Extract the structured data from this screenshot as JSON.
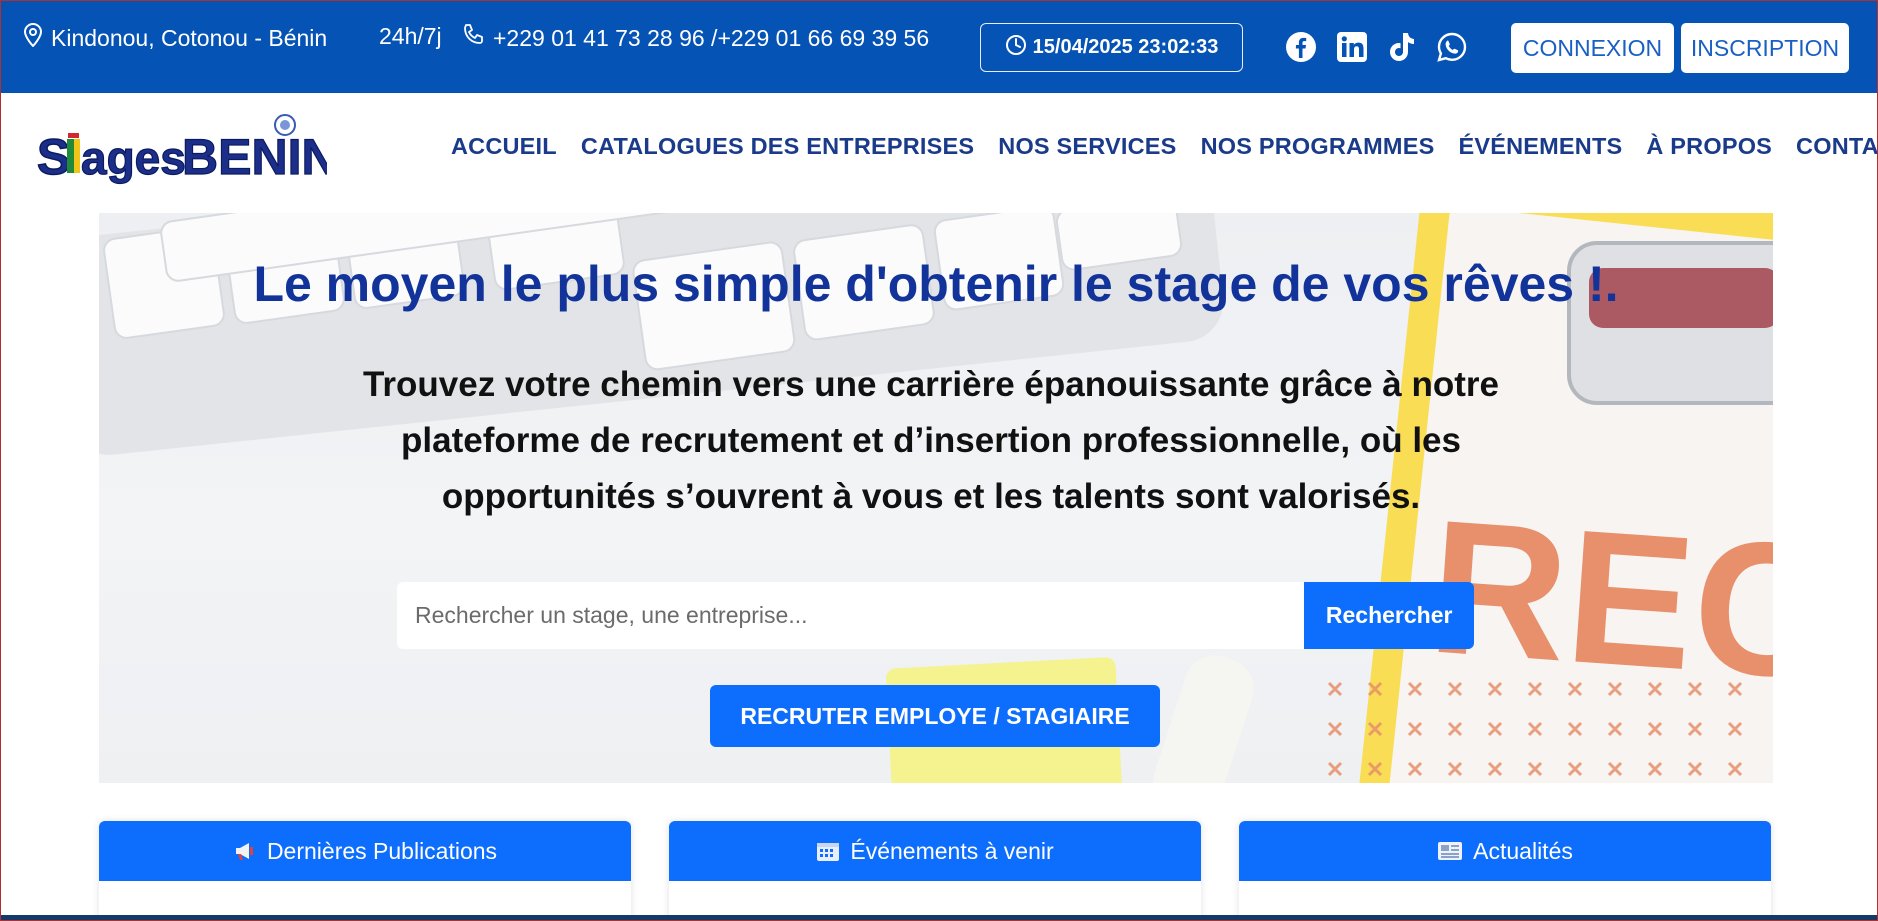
{
  "topbar": {
    "location": "Kindonou, Cotonou - Bénin",
    "hours": "24h/7j",
    "phones": "+229 01 41 73 28 96 /+229 01 66 69 39 56",
    "datetime": "15/04/2025 23:02:33",
    "social": [
      "facebook-icon",
      "linkedin-icon",
      "tiktok-icon",
      "whatsapp-icon"
    ],
    "login_label": "CONNEXION",
    "signup_label": "INSCRIPTION"
  },
  "logo": {
    "text_a": "Stages",
    "text_b": "BENIN"
  },
  "nav": {
    "items": [
      "ACCUEIL",
      "CATALOGUES DES ENTREPRISES",
      "NOS SERVICES",
      "NOS PROGRAMMES",
      "ÉVÉNEMENTS",
      "À PROPOS",
      "CONTACT"
    ]
  },
  "hero": {
    "title": "Le moyen le plus simple d'obtenir le stage de vos rêves !.",
    "subtitle": "Trouvez votre chemin vers une carrière épanouissante grâce à notre plateforme de recrutement et d’insertion professionnelle, où les opportunités s’ouvrent à vous et les talents sont valorisés.",
    "search_placeholder": "Rechercher un stage, une entreprise...",
    "search_button": "Rechercher",
    "recruit_button": "RECRUTER EMPLOYE / STAGIAIRE",
    "background_text": "RECRU"
  },
  "cards": [
    {
      "title": "Dernières Publications",
      "icon": "megaphone-icon"
    },
    {
      "title": "Événements à venir",
      "icon": "calendar-icon"
    },
    {
      "title": "Actualités",
      "icon": "newspaper-icon"
    }
  ],
  "colors": {
    "brand_blue": "#0553b5",
    "nav_text": "#1a3a8a",
    "primary": "#0d6efd",
    "title": "#12339a"
  }
}
